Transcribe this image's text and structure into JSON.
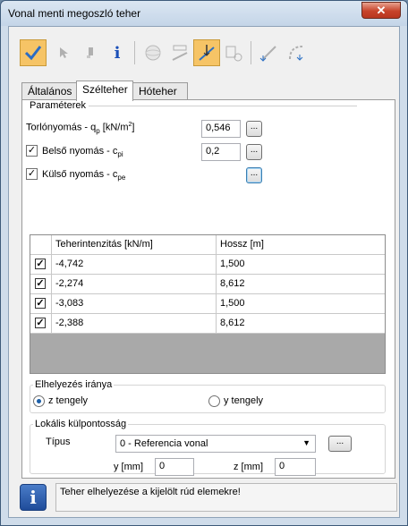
{
  "window": {
    "title": "Vonal menti megoszló teher",
    "close_label": "✕"
  },
  "toolbar": {
    "buttons": [
      {
        "name": "confirm-tool",
        "icon": "checkmark-icon",
        "active": true
      },
      {
        "name": "select-tool",
        "icon": "cursor-icon",
        "active": false
      },
      {
        "name": "pick-tool",
        "icon": "pick-icon",
        "active": false
      },
      {
        "name": "info-tool",
        "icon": "info-icon",
        "active": false,
        "glyph": "i"
      },
      {
        "name": "sphere-tool",
        "icon": "sphere-icon",
        "active": false
      },
      {
        "name": "load-edit-tool",
        "icon": "load-edit-icon",
        "active": false
      },
      {
        "name": "place-load-tool",
        "icon": "place-load-icon",
        "active": true
      },
      {
        "name": "remove-load-tool",
        "icon": "remove-load-icon",
        "active": false
      },
      {
        "name": "line-load-tool",
        "icon": "line-load-icon",
        "active": false
      },
      {
        "name": "arc-load-tool",
        "icon": "arc-load-icon",
        "active": false
      }
    ]
  },
  "tabs": [
    {
      "label": "Általános",
      "active": false
    },
    {
      "label": "Szélteher",
      "active": true
    },
    {
      "label": "Hóteher",
      "active": false
    }
  ],
  "parameters": {
    "group_label": "Paraméterek",
    "torlonyomas_label": "Torlónyomás - q",
    "torlonyomas_sub": "p",
    "torlonyomas_unit": " [kN/m",
    "torlonyomas_sup": "2",
    "torlonyomas_close": "]",
    "torlonyomas_value": "0,546",
    "belso_label": "Belső nyomás - c",
    "belso_sub": "pi",
    "belso_checked": true,
    "belso_value": "0,2",
    "kulso_label": "Külső nyomás - c",
    "kulso_sub": "pe",
    "kulso_checked": true,
    "dots": "..."
  },
  "grid": {
    "columns": [
      "Teherintenzitás [kN/m]",
      "Hossz [m]"
    ],
    "rows": [
      {
        "checked": true,
        "intensity": "-4,742",
        "length": "1,500"
      },
      {
        "checked": true,
        "intensity": "-2,274",
        "length": "8,612"
      },
      {
        "checked": true,
        "intensity": "-3,083",
        "length": "1,500"
      },
      {
        "checked": true,
        "intensity": "-2,388",
        "length": "8,612"
      }
    ]
  },
  "placement": {
    "group_label": "Elhelyezés iránya",
    "option_z": "z tengely",
    "option_y": "y tengely",
    "selected": "z"
  },
  "eccentricity": {
    "group_label": "Lokális külpontosság",
    "type_label": "Típus",
    "type_value": "0 - Referencia vonal",
    "y_label": "y [mm]",
    "y_value": "0",
    "z_label": "z [mm]",
    "z_value": "0"
  },
  "status": {
    "text": "Teher elhelyezése a kijelölt rúd elemekre!",
    "icon": "info-icon",
    "glyph": "i"
  },
  "colors": {
    "accent": "#f6c466",
    "title_bg": "#cfdcea",
    "info_blue": "#1f4c9a"
  }
}
